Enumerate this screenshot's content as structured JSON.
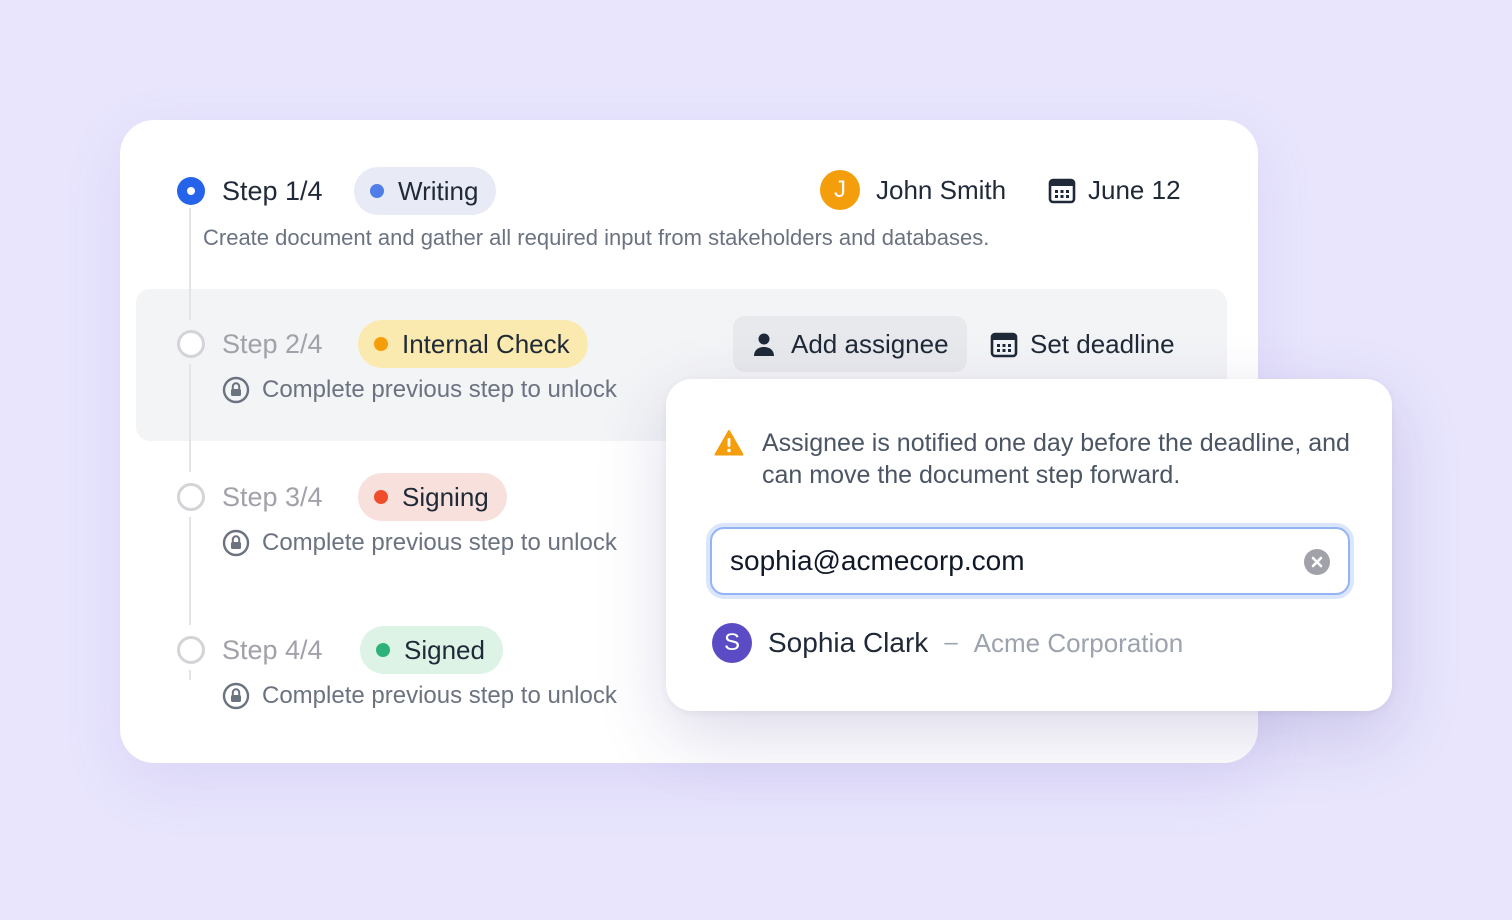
{
  "steps": [
    {
      "label": "Step 1/4",
      "status": "Writing",
      "status_color": "#4f7ee8",
      "status_bg": "#e8eaf5",
      "description": "Create document and gather all required input from stakeholders and databases.",
      "assignee_initial": "J",
      "assignee_name": "John Smith",
      "assignee_color": "#f59e0b",
      "deadline": "June 12"
    },
    {
      "label": "Step 2/4",
      "status": "Internal Check",
      "status_color": "#f59e0b",
      "status_bg": "#fbeab0",
      "lock_text": "Complete previous step to unlock",
      "add_assignee": "Add assignee",
      "set_deadline": "Set deadline"
    },
    {
      "label": "Step 3/4",
      "status": "Signing",
      "status_color": "#f04e2b",
      "status_bg": "#f8e1dc",
      "lock_text": "Complete previous step to unlock"
    },
    {
      "label": "Step 4/4",
      "status": "Signed",
      "status_color": "#2fb27a",
      "status_bg": "#dcf3e6",
      "lock_text": "Complete previous step to unlock"
    }
  ],
  "popover": {
    "warning": "Assignee is notified one day before the deadline, and can move the document step forward.",
    "input_value": "sophia@acmecorp.com",
    "suggestion": {
      "initial": "S",
      "name": "Sophia Clark",
      "separator": "–",
      "company": "Acme Corporation",
      "color": "#5b4bc4"
    }
  },
  "colors": {
    "accent": "#2563eb",
    "background": "#e8e5fd",
    "warning": "#f59e0b"
  }
}
